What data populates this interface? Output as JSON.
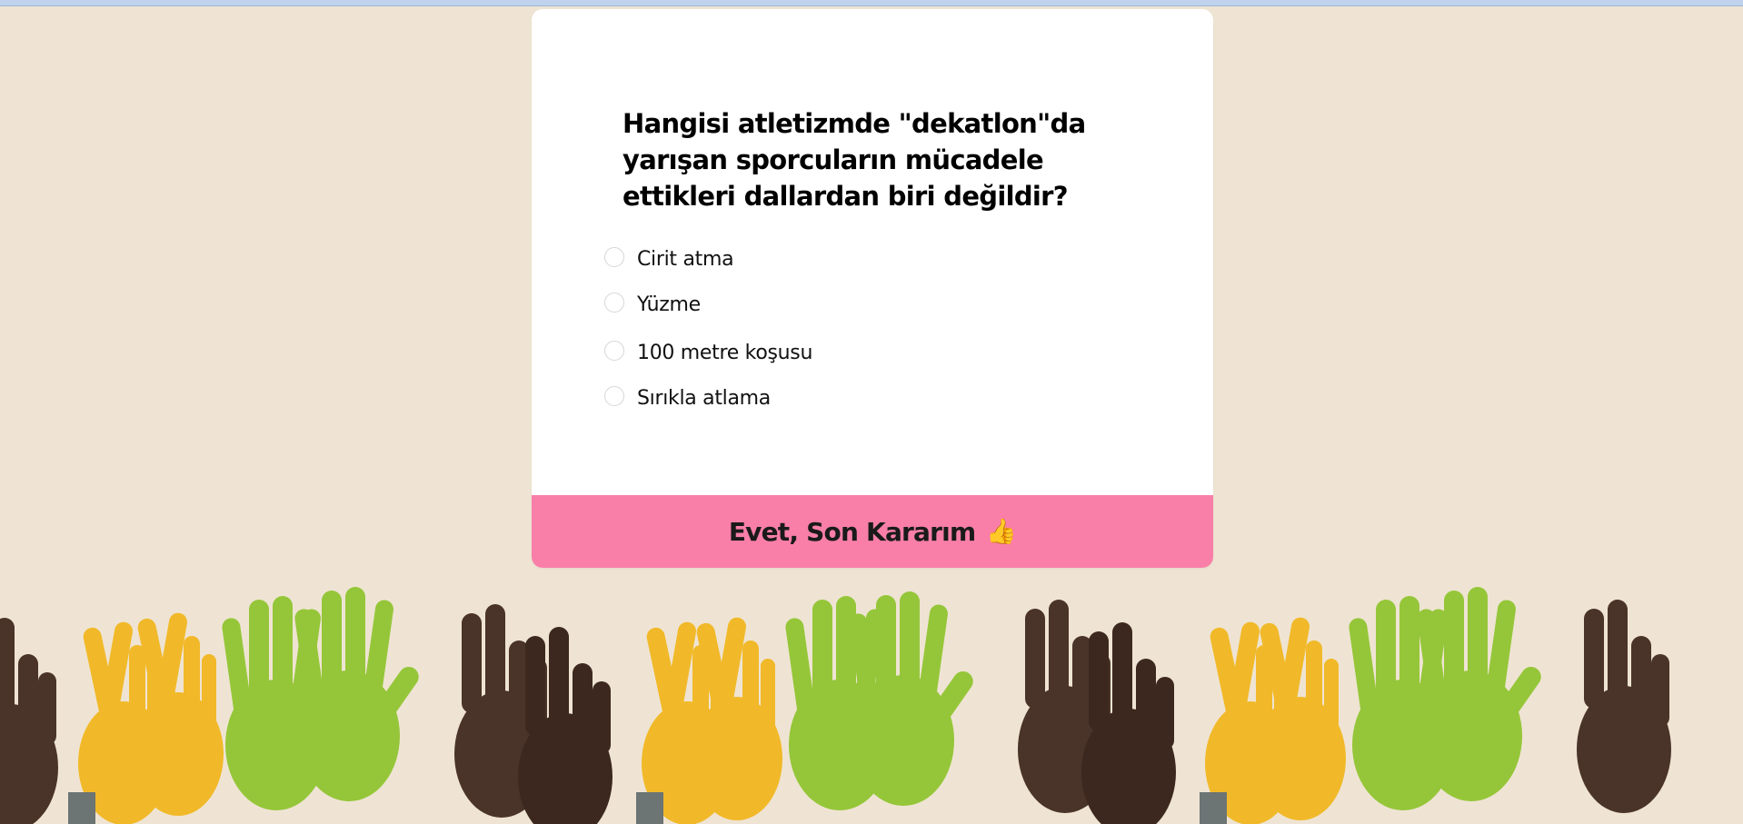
{
  "quiz": {
    "question": "Hangisi atletizmde \"dekatlon\"da yarışan sporcuların mücadele ettikleri dallardan biri değildir?",
    "options": [
      {
        "label": "Cirit atma"
      },
      {
        "label": "Yüzme"
      },
      {
        "label": "100 metre koşusu"
      },
      {
        "label": "Sırıkla atlama"
      }
    ],
    "submit_label": "Evet, Son Kararım",
    "submit_icon": "👍"
  },
  "decoration": {
    "banner_icon": "hands-emoji-banner",
    "colors": {
      "background": "#efe4d3",
      "card": "#ffffff",
      "submit": "#f97fa8",
      "hand_dark": "#4a3328",
      "hand_yellow": "#f1b929",
      "hand_green": "#95c639"
    }
  }
}
